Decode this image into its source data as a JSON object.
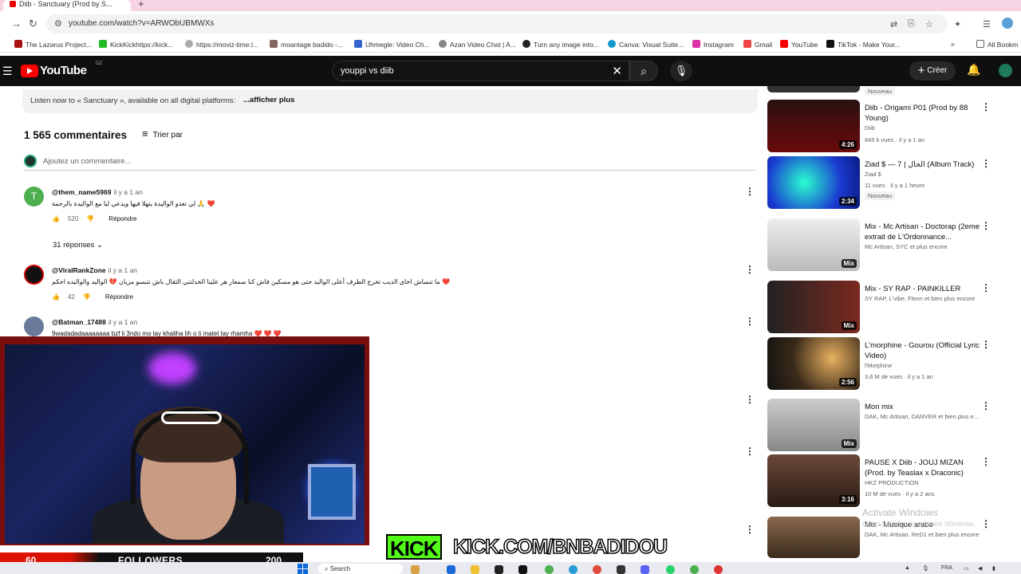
{
  "browser": {
    "tab_title": "Diib - Sanctuary (Prod by S...",
    "url": "youtube.com/watch?v=ARWObUBMWXs",
    "bookmarks": [
      "The Lazarus Project...",
      "KickKickhttps://kick...",
      "https://moviz-time.l...",
      "moantage badido -...",
      "Uhmegle: Video Ch...",
      "Azan Video Chat | A...",
      "Turn any image into...",
      "Canva: Visual Suite...",
      "Instagram",
      "Gmail",
      "YouTube",
      "TikTok - Make Your..."
    ],
    "all_bookmarks": "All Bookm"
  },
  "youtube": {
    "logo_text": "YouTube",
    "region": "DZ",
    "search_query": "youppi vs diib",
    "create_label": "Créer"
  },
  "description": {
    "text": "Listen now to « Sanctuary », available on all digital platforms:",
    "more": "...afficher plus"
  },
  "comments": {
    "count_label": "1 565 commentaires",
    "sort_label": "Trier par",
    "add_placeholder": "Ajoutez un commentaire...",
    "reply_label": "Répondre",
    "replies_toggle": "31 réponses",
    "items": [
      {
        "user": "@them_name5969",
        "when": "il y a 1 an",
        "text": "لي تعدو الواليدة يتهلا فيها ويدعي ليا مع الواليدة بالرحمة 🙏 ❤️",
        "likes": "520"
      },
      {
        "user": "@ViralRankZone",
        "when": "il y a 1 an",
        "text": "ما تنساش اخاي الديب تخرج الطرف أعلى الواليد حتى هو مسكين فاش كنا سمعار هر علينا الخدلتني الثقال باش نتبسو مزيان 💔 الواليد والواليده احكم ❤️",
        "likes": "42"
      },
      {
        "user": "@Batman_17488",
        "when": "il y a 1 an",
        "text": "9wadadadaaaaaaaa bzf li 3ndo mo lay khaliha lih o li matet lay rhamha ❤️ ❤️ ❤️",
        "likes": ""
      }
    ]
  },
  "sidebar": {
    "items": [
      {
        "title": "Diib - Origami P01 (Prod by 88 Young)",
        "channel": "Diib",
        "meta": "845 k vues · il y a 1 an",
        "duration": "4:26",
        "badge": "",
        "color": "#2a1010"
      },
      {
        "title": "Ziad $ — 7 | الحال (Album Track)",
        "channel": "Ziad $",
        "meta": "11 vues · il y a 1 heure",
        "duration": "2:34",
        "badge": "Nouveau",
        "color": "#1a3ad0"
      },
      {
        "title": "Mix - Mc Artisan - Doctorap (2eme extrait de L'Ordonnance...",
        "channel": "Mc Artisan, SYC et plus encore",
        "meta": "",
        "duration": "Mix",
        "badge": "",
        "color": "#dcdcdc"
      },
      {
        "title": "Mix - SY RAP - PAINKILLER",
        "channel": "SY RAP, L'vibe, Flenn et bien plus encore",
        "meta": "",
        "duration": "Mix",
        "badge": "",
        "color": "#3a1a18"
      },
      {
        "title": "L'morphine - Gourou (Official Lyric Video)",
        "channel": "l'Morphine",
        "meta": "3,6 M de vues · il y a 1 an",
        "duration": "2:56",
        "badge": "",
        "color": "#3a2a1a"
      },
      {
        "title": "Mon mix",
        "channel": "DAK, Mc Artisan, DANVER et bien plus e...",
        "meta": "",
        "duration": "Mix",
        "badge": "",
        "color": "#9a9a9a"
      },
      {
        "title": "PAUSE X Diib - JOUJ MIZAN (Prod. by Teaslax x Draconic)",
        "channel": "HKZ PRODUCTION",
        "meta": "10 M de vues · il y a 2 ans",
        "duration": "3:16",
        "badge": "",
        "color": "#4a3328"
      },
      {
        "title": "Mix - Musique arabe",
        "channel": "DAK, Mc Artisan, ReD1 et bien plus encore",
        "meta": "",
        "duration": "",
        "badge": "",
        "color": "#5a4a3a"
      }
    ],
    "top_badge": "Nouveau"
  },
  "windows": {
    "activate_title": "Activate Windows",
    "activate_sub": "Go to Settings to activate Windows.",
    "search": "Search",
    "lang": "FRA"
  },
  "stream": {
    "followers_current": "60",
    "followers_label": "FOLLOWERS",
    "followers_goal": "200",
    "kick_logo": "KICK",
    "kick_url": "KICK.COM/BNBADIDOU"
  }
}
